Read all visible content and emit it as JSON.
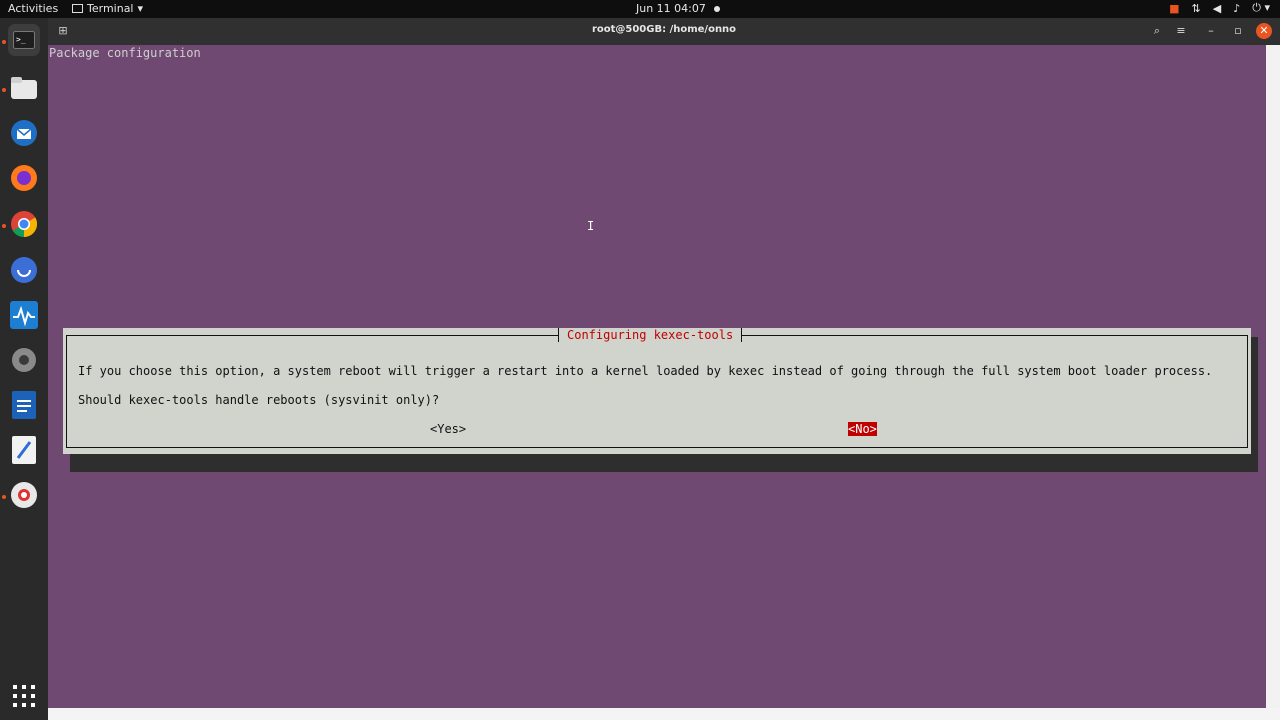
{
  "topbar": {
    "activities": "Activities",
    "app_name": "Terminal",
    "clock": "Jun 11  04:07",
    "tray_icons": [
      "camera-icon",
      "network-icon",
      "volume-icon",
      "mic-icon",
      "power-icon"
    ]
  },
  "window": {
    "title": "root@500GB: /home/onno"
  },
  "terminal": {
    "header": "Package configuration"
  },
  "dialog": {
    "title": "Configuring kexec-tools",
    "message": "If you choose this option, a system reboot will trigger a restart into a kernel loaded by kexec instead of going through the full system boot loader process.",
    "question": "Should kexec-tools handle reboots (sysvinit only)?",
    "yes_label": "<Yes>",
    "no_label": "<No>",
    "selected": "No"
  },
  "colors": {
    "terminal_bg": "#6f4971",
    "dialog_bg": "#d0d4cd",
    "accent": "#c00000",
    "ubuntu_orange": "#e95420"
  },
  "dock": {
    "items": [
      "terminal-icon",
      "files-icon",
      "thunderbird-icon",
      "firefox-icon",
      "chrome-icon",
      "app-icon",
      "monitor-icon",
      "settings-icon",
      "writer-icon",
      "editor-icon",
      "app-center-icon"
    ],
    "show_apps": "show-apps-icon"
  }
}
